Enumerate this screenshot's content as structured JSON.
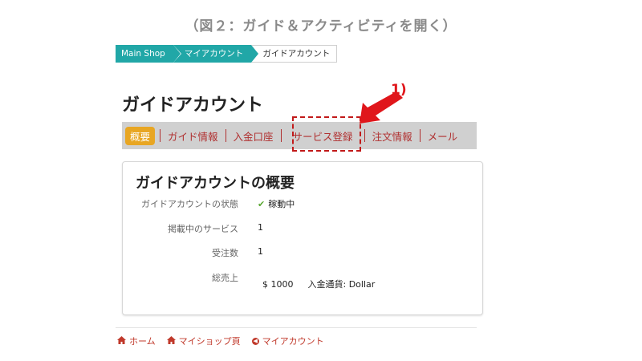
{
  "caption": "（図２：ガイド＆アクティビティを開く）",
  "breadcrumb": [
    "Main Shop",
    "マイアカウント",
    "ガイドアカウント"
  ],
  "page_title": "ガイドアカウント",
  "tabs": {
    "overview": "概要",
    "guide_info": "ガイド情報",
    "bank_account": "入金口座",
    "service_register": "サービス登録",
    "order_info": "注文情報",
    "mail": "メール"
  },
  "annotation": {
    "number": "1)",
    "color": "#e0161b"
  },
  "summary": {
    "title": "ガイドアカウントの概要",
    "status_label": "ガイドアカウントの状態",
    "status_icon": "check-icon",
    "status_value": "稼動中",
    "listed_label": "掲載中のサービス",
    "listed_value": "1",
    "orders_label": "受注数",
    "orders_value": "1",
    "sales_label": "総売上",
    "sales_value": "$ 1000",
    "currency_label": "入金通貨: Dollar"
  },
  "footer": {
    "home": "ホーム",
    "my_shop": "マイショップ頁",
    "my_account": "マイアカウント"
  },
  "colors": {
    "teal": "#21a7a7",
    "active_tab": "#e8a623",
    "link_red": "#b03030"
  }
}
